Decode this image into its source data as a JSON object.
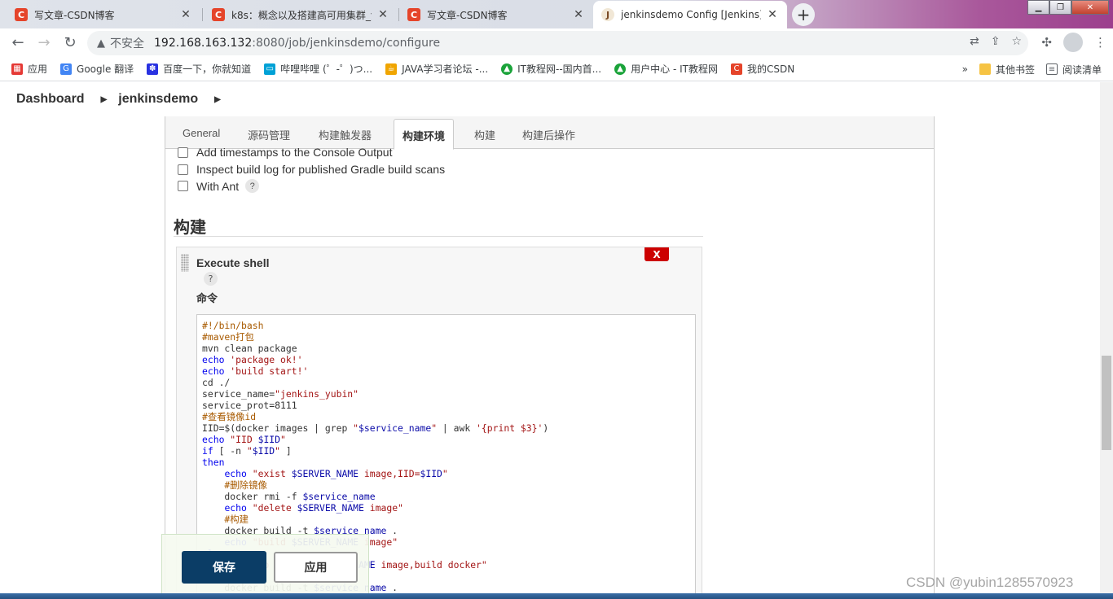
{
  "browser": {
    "tabs": [
      {
        "title": "写文章-CSDN博客",
        "favicon": "C"
      },
      {
        "title": "k8s：概念以及搭建高可用集群_y",
        "favicon": "C"
      },
      {
        "title": "写文章-CSDN博客",
        "favicon": "C"
      },
      {
        "title": "jenkinsdemo Config [Jenkins]",
        "favicon": "J"
      }
    ],
    "new_tab_symbol": "+",
    "close_symbol": "✕",
    "address": {
      "security_label": "不安全",
      "url_host": "192.168.163.132",
      "url_rest": ":8080/job/jenkinsdemo/configure"
    },
    "bookmarks": [
      {
        "label": "应用",
        "icon": "apps-icon",
        "color": "#e53935"
      },
      {
        "label": "Google 翻译",
        "icon": "google-translate-icon",
        "color": "#4285f4"
      },
      {
        "label": "百度一下，你就知道",
        "icon": "baidu-icon",
        "color": "#2932e1"
      },
      {
        "label": "哔哩哔哩 (゜-゜)つ...",
        "icon": "bilibili-icon",
        "color": "#00a1d6"
      },
      {
        "label": "JAVA学习者论坛 -...",
        "icon": "java-icon",
        "color": "#f0a500"
      },
      {
        "label": "IT教程网--国内首...",
        "icon": "it-icon",
        "color": "#1aa33a"
      },
      {
        "label": "用户中心 - IT教程网",
        "icon": "it-icon",
        "color": "#1aa33a"
      },
      {
        "label": "我的CSDN",
        "icon": "csdn-icon",
        "color": "#e5442a"
      }
    ],
    "bookmarks_right": [
      {
        "label": "其他书签"
      },
      {
        "label": "阅读清单"
      }
    ]
  },
  "breadcrumb": {
    "items": [
      "Dashboard",
      "jenkinsdemo"
    ]
  },
  "config_tabs": [
    "General",
    "源码管理",
    "构建触发器",
    "构建环境",
    "构建",
    "构建后操作"
  ],
  "active_tab_index": 3,
  "build_env_options": [
    {
      "label": "Add timestamps to the Console Output",
      "checked": false
    },
    {
      "label": "Inspect build log for published Gradle build scans",
      "checked": false
    },
    {
      "label": "With Ant",
      "checked": false
    }
  ],
  "help_symbol": "?",
  "build_section": {
    "title": "构建",
    "step": {
      "title": "Execute shell",
      "delete_label": "X",
      "command_label": "命令",
      "script_lines": [
        "#!/bin/bash",
        "#maven打包",
        "mvn clean package",
        "echo 'package ok!'",
        "echo 'build start!'",
        "cd ./",
        "service_name=\"jenkins_yubin\"",
        "service_prot=8111",
        "#查看镜像id",
        "IID=$(docker images | grep \"$service_name\" | awk '{print $3}')",
        "echo \"IID $IID\"",
        "if [ -n \"$IID\" ]",
        "then",
        "    echo \"exist $SERVER_NAME image,IID=$IID\"",
        "    #删除镜像",
        "    docker rmi -f $service_name",
        "    echo \"delete $SERVER_NAME image\"",
        "    #构建",
        "    docker build -t $service_name .",
        "    echo \"build $SERVER_NAME image\"",
        "else",
        "    echo \"no exist $SERVER_NAME image,build docker\"",
        "    #构建",
        "    docker build -t $service_name ."
      ]
    }
  },
  "actions": {
    "save_label": "保存",
    "apply_label": "应用"
  },
  "watermark": "CSDN @yubin1285570923",
  "colors": {
    "save_button": "#0b3d66",
    "delete_button": "#cc0000"
  }
}
